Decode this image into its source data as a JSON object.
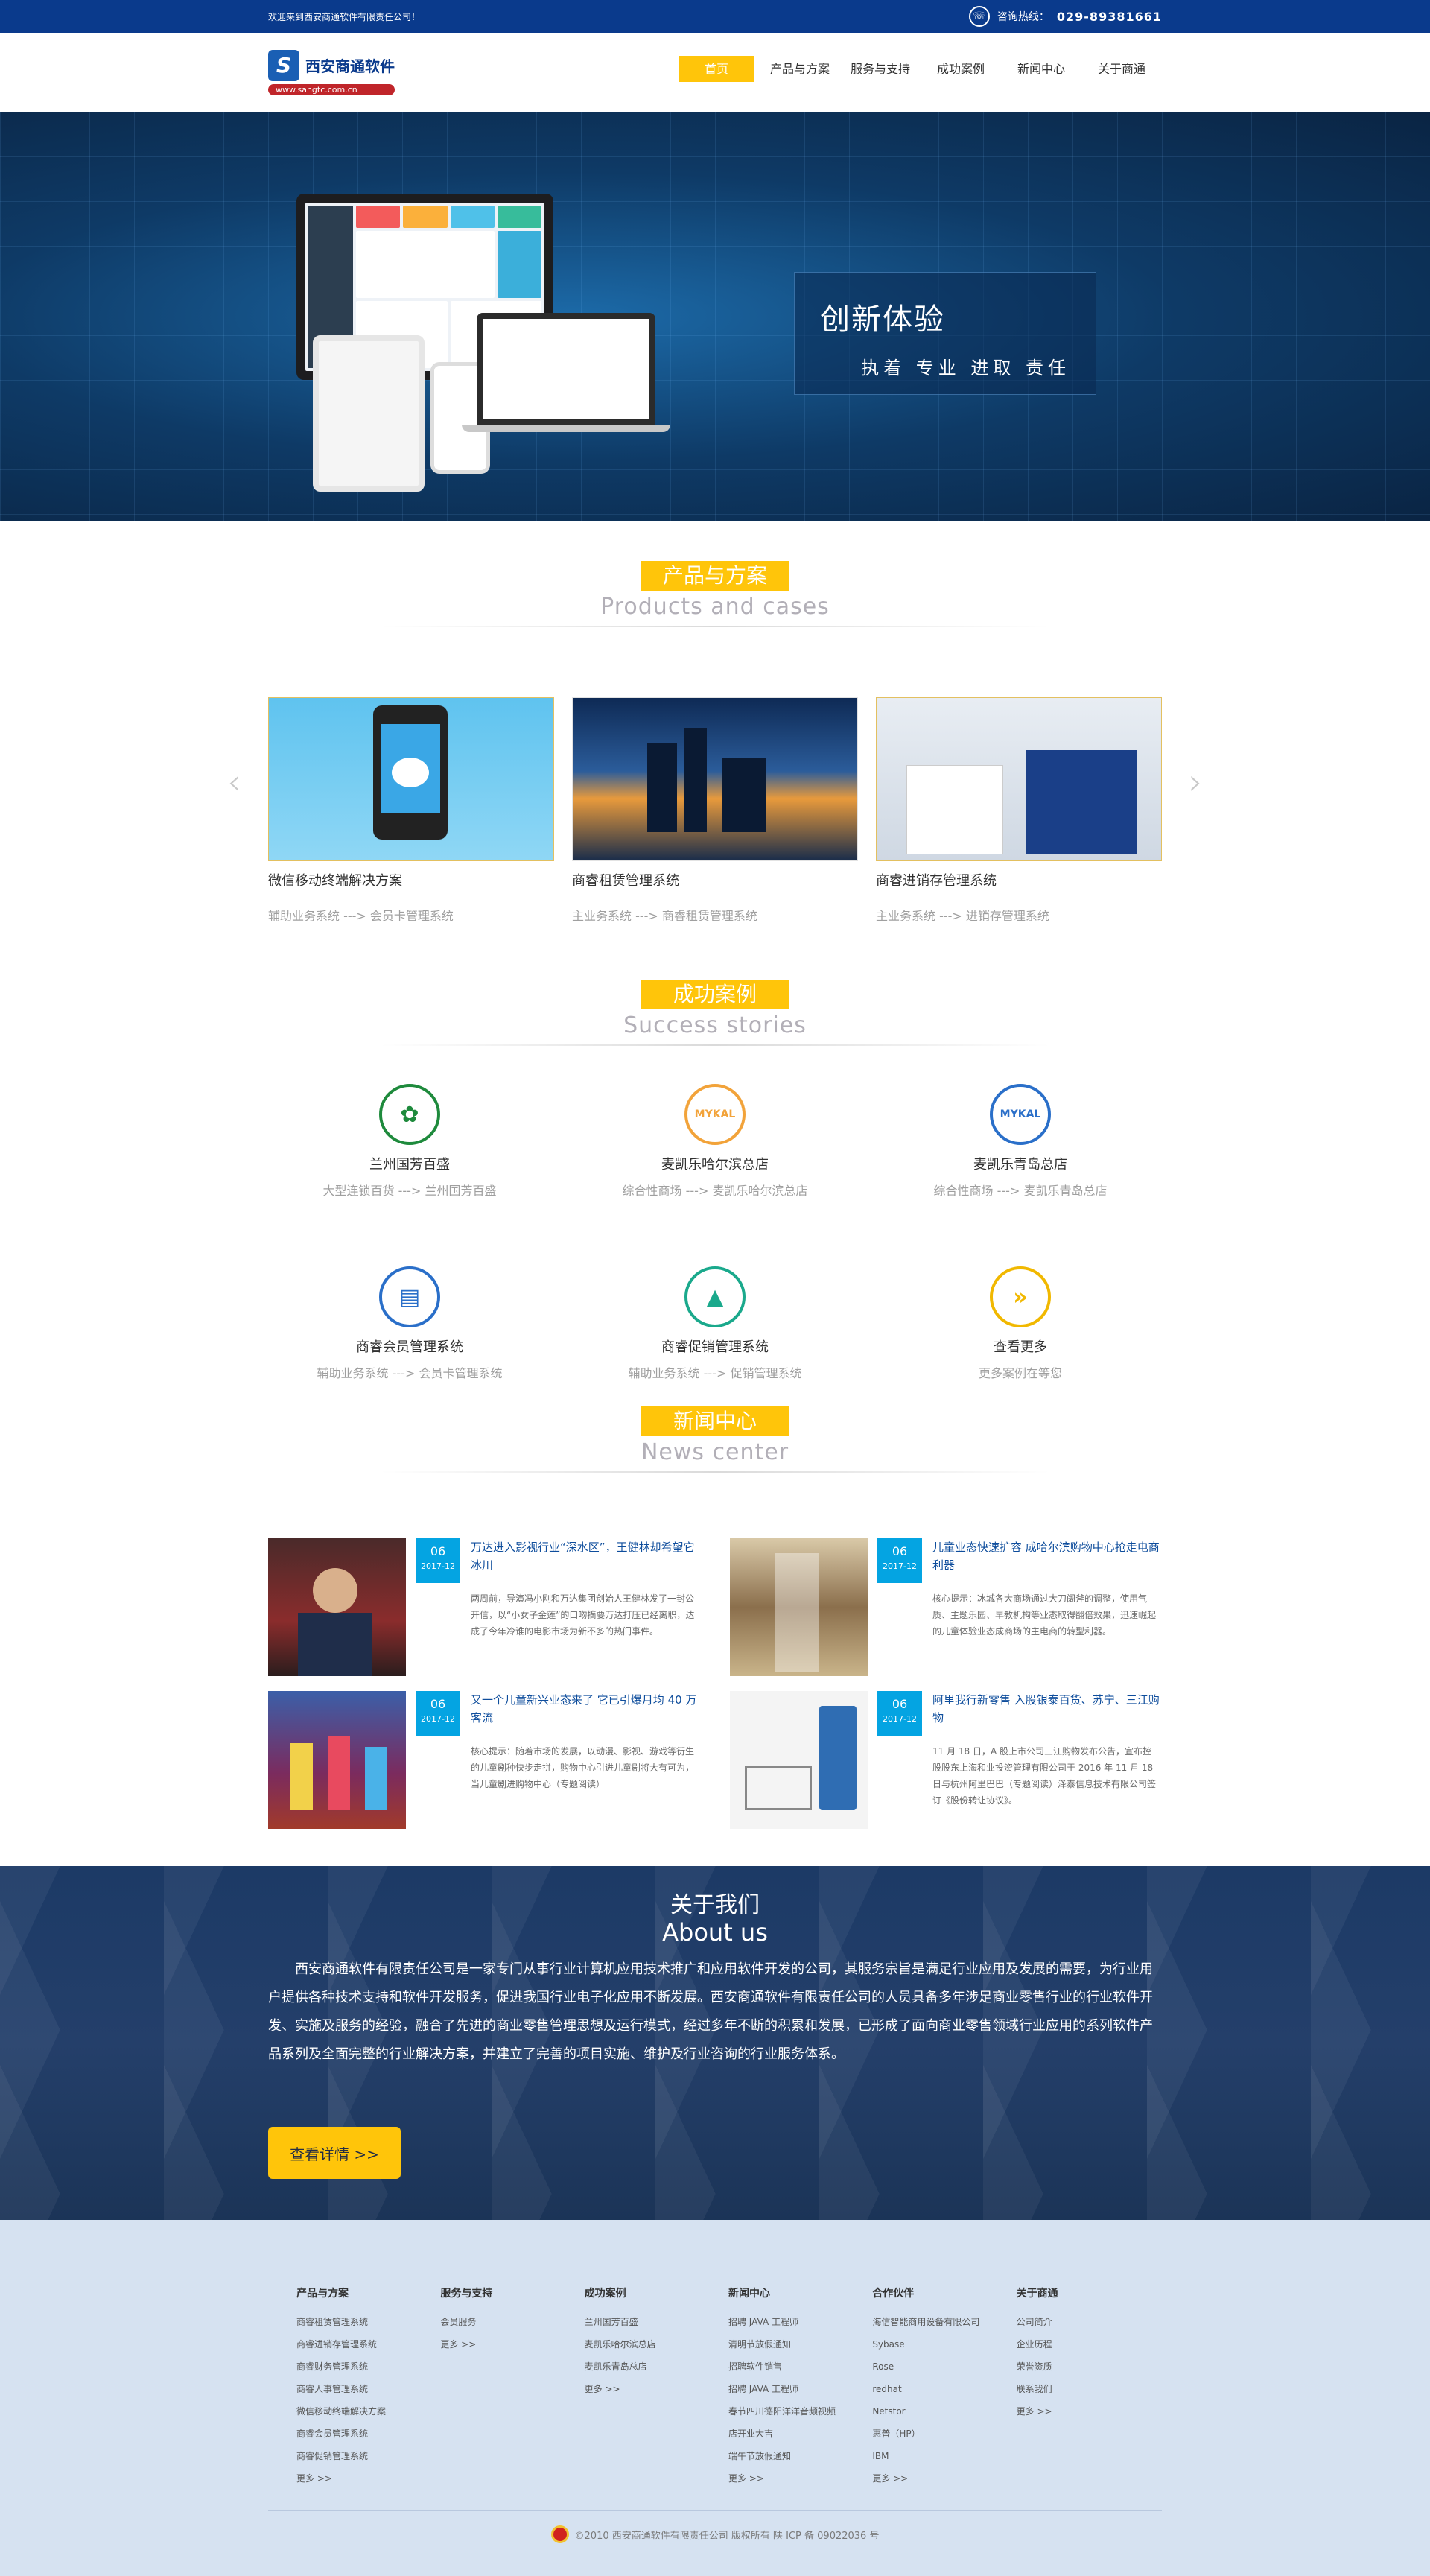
{
  "topbar": {
    "welcome": "欢迎来到西安商通软件有限责任公司！",
    "hotline_label": "咨询热线：",
    "hotline_number": "029-89381661"
  },
  "logo": {
    "name": "西安商通软件",
    "url": "www.sangtc.com.cn"
  },
  "nav": {
    "items": [
      "首页",
      "产品与方案",
      "服务与支持",
      "成功案例",
      "新闻中心",
      "关于商通"
    ],
    "active_color": "#ffc50a"
  },
  "banner": {
    "title": "创新体验",
    "subtitle": "执着  专业  进取  责任"
  },
  "products": {
    "title_cn": "产品与方案",
    "title_en": "Products and cases",
    "items": [
      {
        "name": "微信移动终端解决方案",
        "sub": "辅助业务系统 ---> 会员卡管理系统"
      },
      {
        "name": "商睿租赁管理系统",
        "sub": "主业务系统 ---> 商睿租赁管理系统"
      },
      {
        "name": "商睿进销存管理系统",
        "sub": "主业务系统 ---> 进销存管理系统"
      }
    ]
  },
  "cases": {
    "title_cn": "成功案例",
    "title_en": "Success stories",
    "items": [
      {
        "name": "兰州国芳百盛",
        "sub": "大型连锁百货 ---> 兰州国芳百盛",
        "icon": "leaf-logo-icon",
        "color": "#1e8a3c"
      },
      {
        "name": "麦凯乐哈尔滨总店",
        "sub": "综合性商场 ---> 麦凯乐哈尔滨总店",
        "icon": "mykal-logo-icon",
        "color": "#f2a33a",
        "logo_text": "MYKAL"
      },
      {
        "name": "麦凯乐青岛总店",
        "sub": "综合性商场 ---> 麦凯乐青岛总店",
        "icon": "mykal-logo-icon",
        "color": "#2a6fc9",
        "logo_text": "MYKAL"
      },
      {
        "name": "商睿会员管理系统",
        "sub": "辅助业务系统 ---> 会员卡管理系统",
        "icon": "member-card-icon",
        "color": "#2a6fc9"
      },
      {
        "name": "商睿促销管理系统",
        "sub": "辅助业务系统 ---> 促销管理系统",
        "icon": "promotion-icon",
        "color": "#1aa98c"
      },
      {
        "name": "查看更多",
        "sub": "更多案例在等您",
        "icon": "more-arrow-icon",
        "color": "#f1b800"
      }
    ]
  },
  "news": {
    "title_cn": "新闻中心",
    "title_en": "News center",
    "items": [
      {
        "day": "06",
        "month": "2017-12",
        "title": "万达进入影视行业“深水区”，王健林却希望它冰川",
        "body": "两周前，导演冯小刚和万达集团创始人王健林发了一封公开信，以“小女子金莲”的口吻摘要万达打压已经离职，达成了今年冷谁的电影市场为新不多的热门事件。"
      },
      {
        "day": "06",
        "month": "2017-12",
        "title": "儿童业态快速扩容 成哈尔滨购物中心抢走电商利器",
        "body": "核心提示：冰城各大商场通过大刀阔斧的调整，使用气质、主题乐园、早教机构等业态取得翻倍效果，迅速崛起的儿童体验业态成商场的主电商的转型利器。"
      },
      {
        "day": "06",
        "month": "2017-12",
        "title": "又一个儿童新兴业态来了 它已引爆月均 40 万客流",
        "body": "核心提示：随着市场的发展，以动漫、影视、游戏等衍生的儿童剧种快步走拼，购物中心引进儿童剧将大有可为，当儿童剧进购物中心（专题阅读）"
      },
      {
        "day": "06",
        "month": "2017-12",
        "title": "阿里我行新零售 入股银泰百货、苏宁、三江购物",
        "body": "11 月 18 日，A 股上市公司三江购物发布公告，宣布控股股东上海和业投资管理有限公司于 2016 年 11 月 18 日与杭州阿里巴巴（专题阅读）泽泰信息技术有限公司签订《股份转让协议》。"
      }
    ]
  },
  "about": {
    "title_cn": "关于我们",
    "title_en": "About us",
    "text": "西安商通软件有限责任公司是一家专门从事行业计算机应用技术推广和应用软件开发的公司，其服务宗旨是满足行业应用及发展的需要，为行业用户提供各种技术支持和软件开发服务，促进我国行业电子化应用不断发展。西安商通软件有限责任公司的人员具备多年涉足商业零售行业的行业软件开发、实施及服务的经验，融合了先进的商业零售管理思想及运行模式，经过多年不断的积累和发展，已形成了面向商业零售领域行业应用的系列软件产品系列及全面完整的行业解决方案，并建立了完善的项目实施、维护及行业咨询的行业服务体系。",
    "button": "查看详情 >>"
  },
  "footer": {
    "columns": [
      {
        "title": "产品与方案",
        "items": [
          "商睿租赁管理系统",
          "商睿进销存管理系统",
          "商睿财务管理系统",
          "商睿人事管理系统",
          "微信移动终端解决方案",
          "商睿会员管理系统",
          "商睿促销管理系统",
          "更多 >>"
        ]
      },
      {
        "title": "服务与支持",
        "items": [
          "会员服务",
          "更多 >>"
        ]
      },
      {
        "title": "成功案例",
        "items": [
          "兰州国芳百盛",
          "麦凯乐哈尔滨总店",
          "麦凯乐青岛总店",
          "更多 >>"
        ]
      },
      {
        "title": "新闻中心",
        "items": [
          "招聘 JAVA 工程师",
          "清明节放假通知",
          "招聘软件销售",
          "招聘 JAVA 工程师",
          "春节四川德阳洋洋音频视频",
          "店开业大吉",
          "端午节放假通知",
          "更多 >>"
        ]
      },
      {
        "title": "合作伙伴",
        "items": [
          "海信智能商用设备有限公司",
          "Sybase",
          "Rose",
          "redhat",
          "Netstor",
          "惠普（HP）",
          "IBM",
          "更多 >>"
        ]
      },
      {
        "title": "关于商通",
        "items": [
          "公司简介",
          "企业历程",
          "荣誉资质",
          "联系我们",
          "更多 >>"
        ]
      }
    ],
    "copyright": "©2010 西安商通软件有限责任公司 版权所有   陕 ICP 备 09022036 号"
  }
}
